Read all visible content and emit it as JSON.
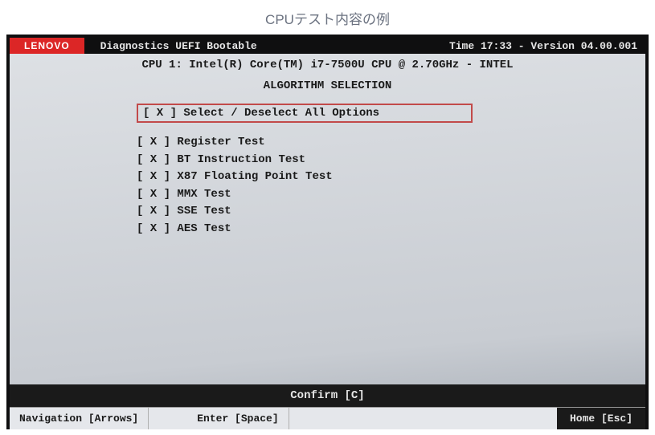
{
  "caption": "CPUテスト内容の例",
  "header": {
    "brand": "LENOVO",
    "title": "Diagnostics UEFI Bootable",
    "time_label": "Time 17:33",
    "version_label": "- Version 04.00.001"
  },
  "cpu_info": "CPU 1: Intel(R) Core(TM) i7-7500U CPU @ 2.70GHz - INTEL",
  "section_title": "ALGORITHM SELECTION",
  "select_all": {
    "mark": "[ X ]",
    "label": "Select / Deselect All Options"
  },
  "options": [
    {
      "mark": "[ X ]",
      "label": "Register Test"
    },
    {
      "mark": "[ X ]",
      "label": "BT Instruction Test"
    },
    {
      "mark": "[ X ]",
      "label": "X87 Floating Point Test"
    },
    {
      "mark": "[ X ]",
      "label": "MMX Test"
    },
    {
      "mark": "[ X ]",
      "label": "SSE Test"
    },
    {
      "mark": "[ X ]",
      "label": "AES Test"
    }
  ],
  "confirm_label": "Confirm [C]",
  "footer": {
    "navigation": "Navigation [Arrows]",
    "enter": "Enter [Space]",
    "home": "Home [Esc]"
  }
}
